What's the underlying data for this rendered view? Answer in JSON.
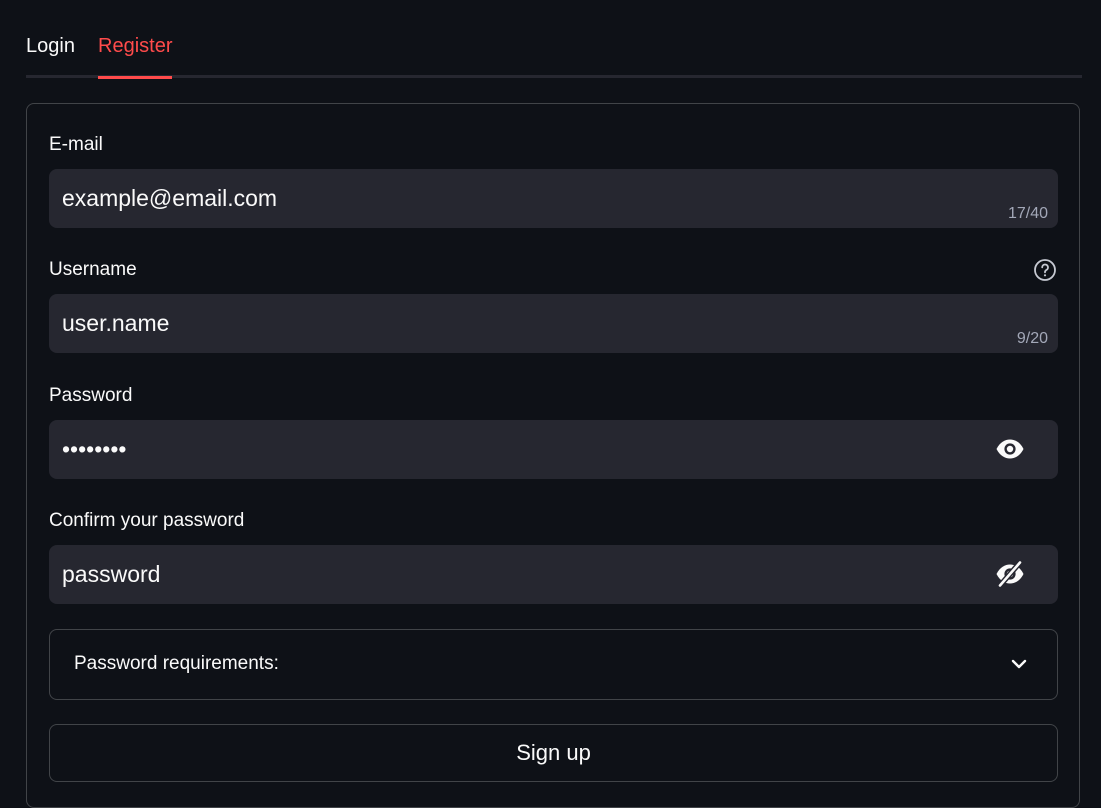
{
  "tabs": [
    {
      "label": "Login",
      "active": false
    },
    {
      "label": "Register",
      "active": true
    }
  ],
  "colors": {
    "background": "#0e1117",
    "input_background": "#262730",
    "accent": "#ff4b4b",
    "text": "#fafafa",
    "muted_text": "#a3a8b8"
  },
  "form": {
    "email": {
      "label": "E-mail",
      "value": "example@email.com",
      "counter": "17/40"
    },
    "username": {
      "label": "Username",
      "value": "user.name",
      "counter": "9/20",
      "help_icon": "question-circle-icon"
    },
    "password": {
      "label": "Password",
      "value": "password",
      "masked": true,
      "toggle_icon": "eye-icon"
    },
    "confirm_password": {
      "label": "Confirm your password",
      "value": "password",
      "masked": false,
      "toggle_icon": "eye-slash-icon"
    },
    "requirements": {
      "label": "Password requirements:",
      "expanded": false,
      "icon": "chevron-down-icon"
    },
    "submit_label": "Sign up"
  }
}
